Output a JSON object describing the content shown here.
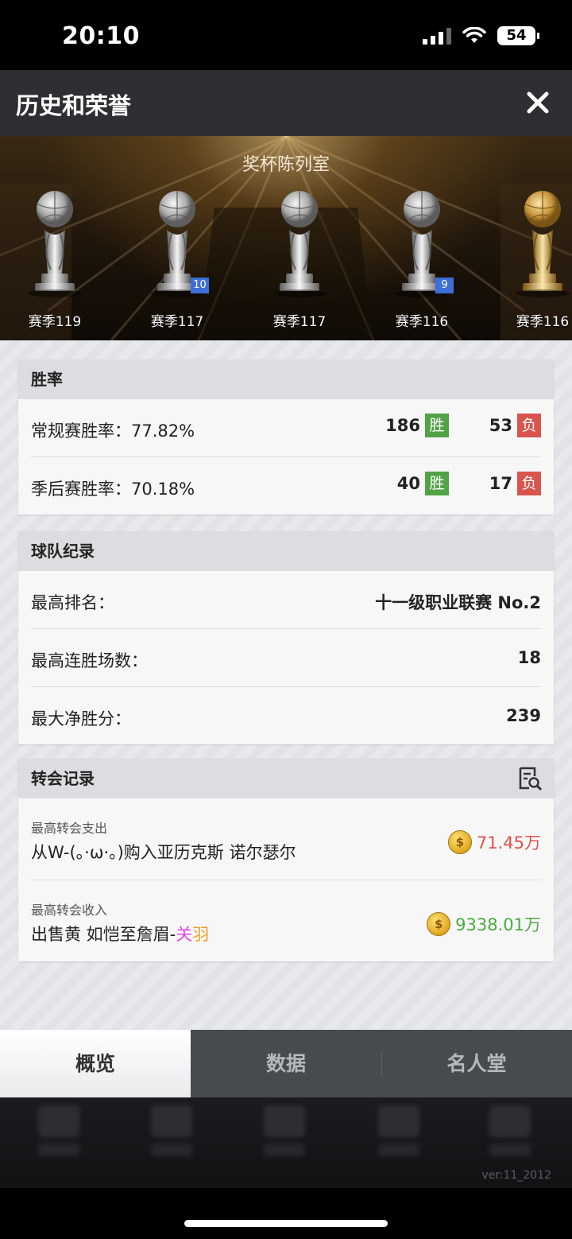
{
  "status_bar": {
    "time": "20:10",
    "battery": "54"
  },
  "header": {
    "title": "历史和荣誉"
  },
  "trophy_room": {
    "title": "奖杯陈列室",
    "trophies": [
      {
        "season": "赛季119",
        "badge": "",
        "material": "silver"
      },
      {
        "season": "赛季117",
        "badge": "10",
        "material": "silver"
      },
      {
        "season": "赛季117",
        "badge": "",
        "material": "silver"
      },
      {
        "season": "赛季116",
        "badge": "9",
        "material": "silver"
      },
      {
        "season": "赛季116",
        "badge": "",
        "material": "gold"
      }
    ]
  },
  "win_rate": {
    "heading": "胜率",
    "rows": [
      {
        "label": "常规赛胜率：77.82%",
        "wins": "186",
        "win_tag": "胜",
        "losses": "53",
        "loss_tag": "负"
      },
      {
        "label": "季后赛胜率：70.18%",
        "wins": "40",
        "win_tag": "胜",
        "losses": "17",
        "loss_tag": "负"
      }
    ]
  },
  "team_record": {
    "heading": "球队纪录",
    "rows": [
      {
        "label": "最高排名：",
        "value": "十一级职业联赛 No.2"
      },
      {
        "label": "最高连胜场数：",
        "value": "18"
      },
      {
        "label": "最大净胜分：",
        "value": "239"
      }
    ]
  },
  "transfer_record": {
    "heading": "转会记录",
    "rows": [
      {
        "caption": "最高转会支出",
        "desc": "从W-(。·ω·。)购入亚历克斯 诺尔瑟尔",
        "desc_highlight_1": "",
        "desc_highlight_2": "",
        "amount": "71.45万",
        "amount_color": "#e0524a"
      },
      {
        "caption": "最高转会收入",
        "desc": "出售黄 如恺至詹眉-",
        "desc_highlight_1": "关",
        "desc_highlight_2": "羽",
        "amount": "9338.01万",
        "amount_color": "#4bab3c"
      }
    ]
  },
  "tabs": [
    {
      "label": "概览",
      "active": true
    },
    {
      "label": "数据",
      "active": false
    },
    {
      "label": "名人堂",
      "active": false
    }
  ],
  "footer": {
    "version": "ver:11_2012"
  },
  "colors": {
    "win": "#52a246",
    "loss": "#d8544d",
    "highlight_magenta": "#e04be0",
    "highlight_orange": "#f0a020"
  }
}
